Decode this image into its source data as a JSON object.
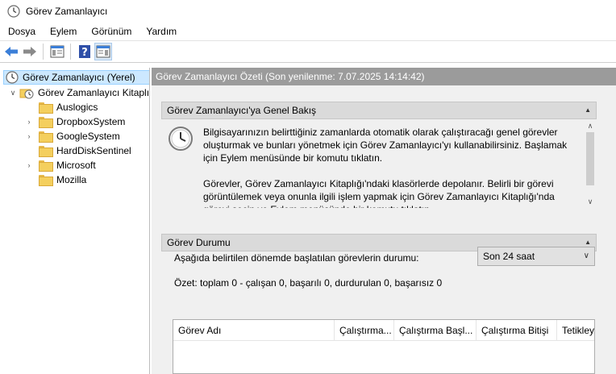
{
  "window": {
    "title": "Görev Zamanlayıcı"
  },
  "menu": {
    "items": [
      "Dosya",
      "Eylem",
      "Görünüm",
      "Yardım"
    ]
  },
  "toolbar": {
    "buttons": [
      "back-icon",
      "forward-icon",
      "console-tree-icon",
      "help-icon",
      "action-pane-icon"
    ]
  },
  "tree": {
    "root": "Görev Zamanlayıcı (Yerel)",
    "library": "Görev Zamanlayıcı Kitaplığı",
    "folders": [
      "Auslogics",
      "DropboxSystem",
      "GoogleSystem",
      "HardDiskSentinel",
      "Microsoft",
      "Mozilla"
    ],
    "expandable": [
      false,
      true,
      true,
      false,
      true,
      false
    ]
  },
  "main": {
    "header": "Görev Zamanlayıcı Özeti (Son yenilenme: 7.07.2025 14:14:42)",
    "overview": {
      "title": "Görev Zamanlayıcı'ya Genel Bakış",
      "para1": "Bilgisayarınızın belirttiğiniz zamanlarda otomatik olarak çalıştıracağı genel görevler oluşturmak ve bunları yönetmek için Görev Zamanlayıcı'yı kullanabilirsiniz. Başlamak için Eylem menüsünde bir komutu tıklatın.",
      "para2": "Görevler, Görev Zamanlayıcı Kitaplığı'ndaki klasörlerde depolanır. Belirli bir görevi görüntülemek veya onunla ilgili işlem yapmak için Görev Zamanlayıcı Kitaplığı'nda görevi seçin ve Eylem menüsünde bir komutu tıklatın."
    },
    "status": {
      "title": "Görev Durumu",
      "label": "Aşağıda belirtilen dönemde başlatılan görevlerin durumu:",
      "period": "Son 24 saat",
      "summary": "Özet: toplam 0 - çalışan 0, başarılı 0, durdurulan 0, başarısız 0",
      "columns": [
        "Görev Adı",
        "Çalıştırma...",
        "Çalıştırma Başl...",
        "Çalıştırma Bitişi",
        "Tetikley"
      ]
    }
  },
  "colors": {
    "selection": "#cce8ff",
    "header_bar": "#9b9b9b",
    "section": "#dadada"
  }
}
